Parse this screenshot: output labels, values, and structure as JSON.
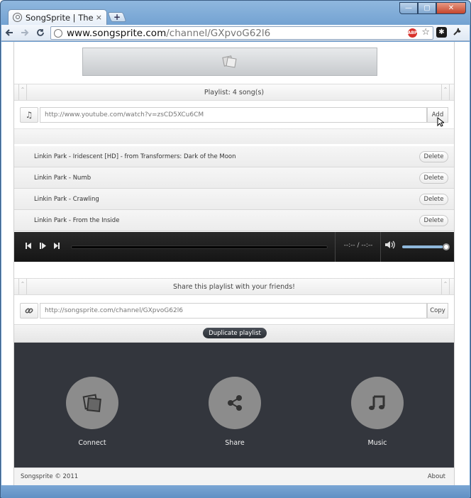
{
  "browser": {
    "tab_title": "SongSprite | The colla",
    "tab_close": "×",
    "newtab_label": "+",
    "url_host": "www.songsprite.com",
    "url_path": "/channel/GXpvoG62l6",
    "abp_label": "ABP",
    "minimize": "—",
    "maximize": "▢",
    "close": "✕"
  },
  "playlist": {
    "header": "Playlist: 4 song(s)",
    "input_value": "http://www.youtube.com/watch?v=zsCD5XCu6CM",
    "add_label": "Add",
    "delete_label": "Delete",
    "songs": [
      "Linkin Park - Iridescent [HD] - from Transformers: Dark of the Moon",
      "Linkin Park - Numb",
      "Linkin Park - Crawling",
      "Linkin Park - From the Inside"
    ]
  },
  "player": {
    "time": "--:-- / --:--",
    "volume_fraction": 0.95
  },
  "share": {
    "header": "Share this playlist with your friends!",
    "link_value": "http://songsprite.com/channel/GXpvoG62l6",
    "copy_label": "Copy",
    "duplicate_label": "Duplicate playlist"
  },
  "features": [
    {
      "label": "Connect",
      "icon": "photos-icon"
    },
    {
      "label": "Share",
      "icon": "share-icon"
    },
    {
      "label": "Music",
      "icon": "music-note-icon"
    }
  ],
  "footer": {
    "copyright": "Songsprite © 2011",
    "about": "About"
  },
  "colors": {
    "dark_footer": "#33363d",
    "player_bg": "#1c1c1c",
    "feature_circle": "#8c8c8c"
  }
}
